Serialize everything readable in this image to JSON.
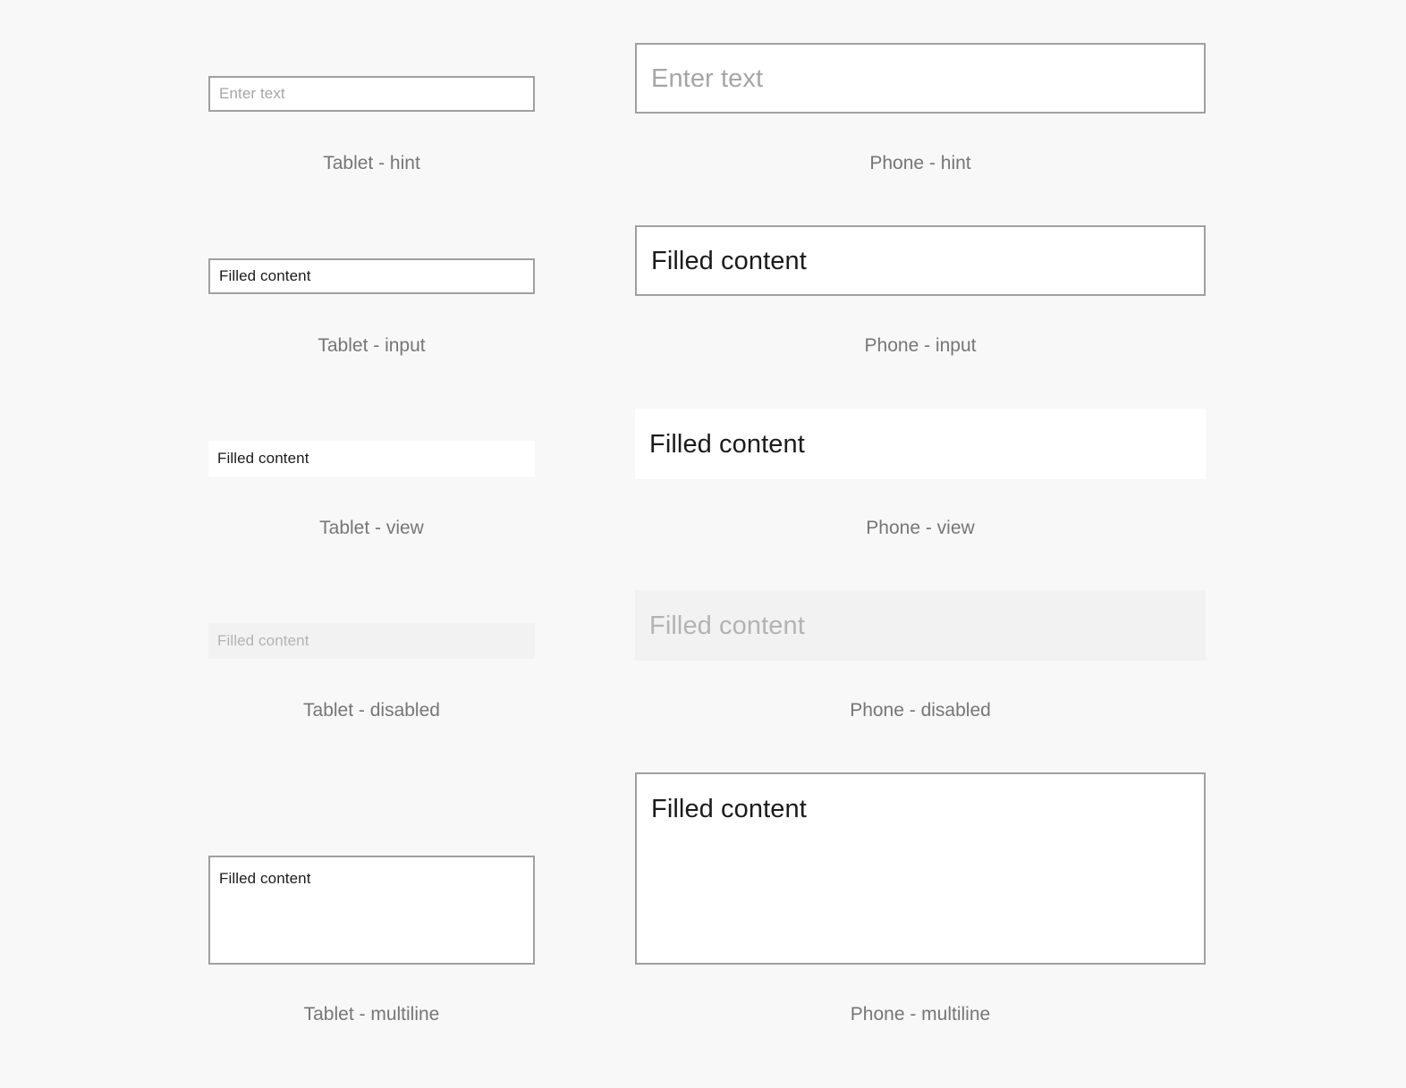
{
  "page": {
    "background_color": "#f8f8f8",
    "border_color": "#a0a0a0",
    "text_color": "#1b1b1b",
    "placeholder_color": "#a6a6a6",
    "disabled_text_color": "#b3b3b3",
    "disabled_background_color": "#f2f2f2",
    "caption_color": "#767676",
    "field_background_color": "#ffffff"
  },
  "columns": [
    {
      "key": "tablet",
      "name": "Tablet"
    },
    {
      "key": "phone",
      "name": "Phone"
    }
  ],
  "rows": [
    {
      "state": "hint",
      "tablet": {
        "value": "",
        "placeholder": "Enter text",
        "caption": "Tablet - hint"
      },
      "phone": {
        "value": "",
        "placeholder": "Enter text",
        "caption": "Phone - hint"
      }
    },
    {
      "state": "input",
      "tablet": {
        "value": "Filled content",
        "placeholder": "",
        "caption": "Tablet - input"
      },
      "phone": {
        "value": "Filled content",
        "placeholder": "",
        "caption": "Phone - input"
      }
    },
    {
      "state": "view",
      "tablet": {
        "value": "Filled content",
        "placeholder": "",
        "caption": "Tablet - view"
      },
      "phone": {
        "value": "Filled content",
        "placeholder": "",
        "caption": "Phone - view"
      }
    },
    {
      "state": "disabled",
      "tablet": {
        "value": "Filled content",
        "placeholder": "",
        "caption": "Tablet - disabled"
      },
      "phone": {
        "value": "Filled content",
        "placeholder": "",
        "caption": "Phone - disabled"
      }
    },
    {
      "state": "multiline",
      "tablet": {
        "value": "Filled content",
        "placeholder": "",
        "caption": "Tablet - multiline"
      },
      "phone": {
        "value": "Filled content",
        "placeholder": "",
        "caption": "Phone - multiline"
      }
    }
  ]
}
